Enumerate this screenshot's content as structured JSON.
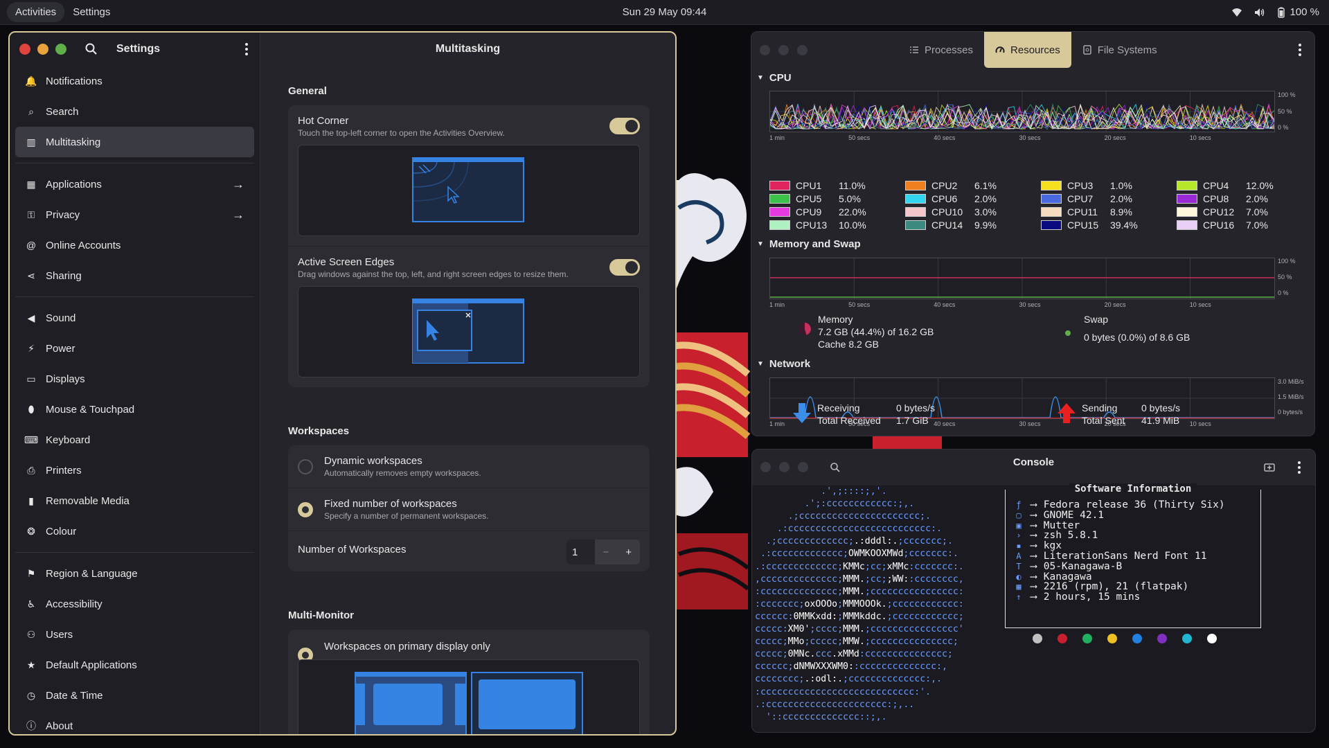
{
  "topbar": {
    "activities": "Activities",
    "app": "Settings",
    "clock": "Sun 29 May  09:44",
    "battery": "100 %"
  },
  "settings": {
    "title": "Settings",
    "page_title": "Multitasking",
    "sidebar": [
      {
        "label": "Notifications",
        "icon": "bell-icon"
      },
      {
        "label": "Search",
        "icon": "search-icon"
      },
      {
        "label": "Multitasking",
        "icon": "multitasking-icon",
        "active": true
      },
      {
        "label": "Applications",
        "icon": "grid-icon",
        "arrow": true
      },
      {
        "label": "Privacy",
        "icon": "key-icon",
        "arrow": true
      },
      {
        "label": "Online Accounts",
        "icon": "at-icon"
      },
      {
        "label": "Sharing",
        "icon": "share-icon"
      },
      {
        "label": "Sound",
        "icon": "speaker-icon"
      },
      {
        "label": "Power",
        "icon": "power-icon"
      },
      {
        "label": "Displays",
        "icon": "display-icon"
      },
      {
        "label": "Mouse & Touchpad",
        "icon": "mouse-icon"
      },
      {
        "label": "Keyboard",
        "icon": "keyboard-icon"
      },
      {
        "label": "Printers",
        "icon": "printer-icon"
      },
      {
        "label": "Removable Media",
        "icon": "usb-icon"
      },
      {
        "label": "Colour",
        "icon": "palette-icon"
      },
      {
        "label": "Region & Language",
        "icon": "flag-icon"
      },
      {
        "label": "Accessibility",
        "icon": "accessibility-icon"
      },
      {
        "label": "Users",
        "icon": "users-icon"
      },
      {
        "label": "Default Applications",
        "icon": "star-icon"
      },
      {
        "label": "Date & Time",
        "icon": "clock-icon"
      },
      {
        "label": "About",
        "icon": "info-icon"
      }
    ],
    "general": {
      "heading": "General",
      "hot_corner_title": "Hot Corner",
      "hot_corner_desc": "Touch the top-left corner to open the Activities Overview.",
      "edges_title": "Active Screen Edges",
      "edges_desc": "Drag windows against the top, left, and right screen edges to resize them."
    },
    "workspaces": {
      "heading": "Workspaces",
      "dynamic_title": "Dynamic workspaces",
      "dynamic_desc": "Automatically removes empty workspaces.",
      "fixed_title": "Fixed number of workspaces",
      "fixed_desc": "Specify a number of permanent workspaces.",
      "number_label": "Number of Workspaces",
      "number_value": "1",
      "minus": "−",
      "plus": "+"
    },
    "multimonitor": {
      "heading": "Multi-Monitor",
      "primary_only": "Workspaces on primary display only"
    }
  },
  "sysmon": {
    "tabs": [
      {
        "label": "Processes"
      },
      {
        "label": "Resources",
        "active": true
      },
      {
        "label": "File Systems"
      }
    ],
    "cpu_heading": "CPU",
    "mem_heading": "Memory and Swap",
    "net_heading": "Network",
    "time_ticks": [
      "1 min",
      "50 secs",
      "40 secs",
      "30 secs",
      "20 secs",
      "10 secs",
      ""
    ],
    "pct_ticks": [
      "100 %",
      "50 %",
      "0 %"
    ],
    "net_ticks": [
      "3.0 MiB/s",
      "1.5 MiB/s",
      "0 bytes/s"
    ],
    "cpus": [
      {
        "name": "CPU1",
        "pct": "11.0%",
        "color": "#e0245e"
      },
      {
        "name": "CPU2",
        "pct": "6.1%",
        "color": "#f0801e"
      },
      {
        "name": "CPU3",
        "pct": "1.0%",
        "color": "#f4e01e"
      },
      {
        "name": "CPU4",
        "pct": "12.0%",
        "color": "#b8e82a"
      },
      {
        "name": "CPU5",
        "pct": "5.0%",
        "color": "#3cc24a"
      },
      {
        "name": "CPU6",
        "pct": "2.0%",
        "color": "#32d6f0"
      },
      {
        "name": "CPU7",
        "pct": "2.0%",
        "color": "#4a6be0"
      },
      {
        "name": "CPU8",
        "pct": "2.0%",
        "color": "#9a2ad6"
      },
      {
        "name": "CPU9",
        "pct": "22.0%",
        "color": "#e43ae0"
      },
      {
        "name": "CPU10",
        "pct": "3.0%",
        "color": "#f6c8cc"
      },
      {
        "name": "CPU11",
        "pct": "8.9%",
        "color": "#f6dcc0"
      },
      {
        "name": "CPU12",
        "pct": "7.0%",
        "color": "#fff8dc"
      },
      {
        "name": "CPU13",
        "pct": "10.0%",
        "color": "#aef0c0"
      },
      {
        "name": "CPU14",
        "pct": "9.9%",
        "color": "#3a8a80"
      },
      {
        "name": "CPU15",
        "pct": "39.4%",
        "color": "#0a0a80"
      },
      {
        "name": "CPU16",
        "pct": "7.0%",
        "color": "#e8d0f6"
      }
    ],
    "memory": {
      "label": "Memory",
      "value": "7.2 GB (44.4%) of 16.2 GB",
      "cache": "Cache 8.2 GB",
      "swap_label": "Swap",
      "swap_value": "0 bytes (0.0%) of 8.6 GB"
    },
    "network": {
      "receiving": "Receiving",
      "receiving_val": "0 bytes/s",
      "total_received": "Total Received",
      "total_received_val": "1.7 GiB",
      "sending": "Sending",
      "sending_val": "0 bytes/s",
      "total_sent": "Total Sent",
      "total_sent_val": "41.9 MiB"
    }
  },
  "console": {
    "title": "Console",
    "info_title": "Software Information",
    "info": [
      {
        "icon": "fedora-icon",
        "text": "Fedora release 36 (Thirty Six)"
      },
      {
        "icon": "window-icon",
        "text": "GNOME 42.1"
      },
      {
        "icon": "wm-icon",
        "text": "Mutter"
      },
      {
        "icon": "terminal-icon",
        "text": "zsh 5.8.1"
      },
      {
        "icon": "term-emulator-icon",
        "text": "kgx"
      },
      {
        "icon": "font-icon",
        "text": "LiterationSans Nerd Font 11"
      },
      {
        "icon": "theme-icon",
        "text": "05-Kanagawa-B"
      },
      {
        "icon": "colorscheme-icon",
        "text": "Kanagawa"
      },
      {
        "icon": "packages-icon",
        "text": "2216 (rpm), 21 (flatpak)"
      },
      {
        "icon": "uptime-icon",
        "text": "2 hours, 15 mins"
      }
    ],
    "arrow": "⟶",
    "color_dots": [
      "#c0c0c0",
      "#c8202c",
      "#20b060",
      "#f0c020",
      "#2080e0",
      "#8030c0",
      "#20b8d0",
      "#ffffff"
    ]
  }
}
